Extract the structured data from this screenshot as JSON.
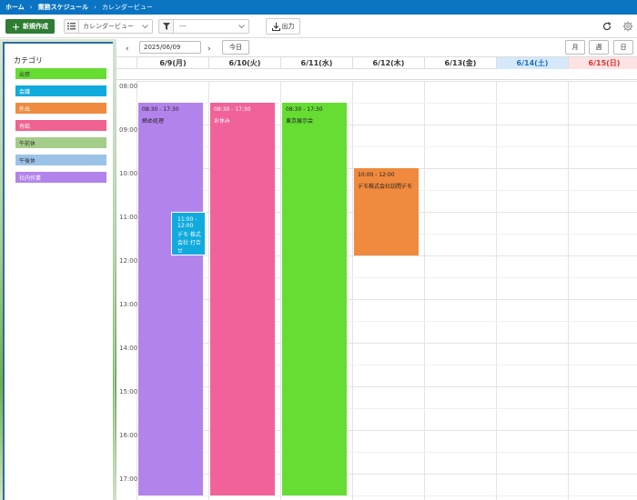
{
  "breadcrumb": [
    "ホーム",
    "業務スケジュール",
    "カレンダービュー"
  ],
  "toolbar": {
    "new_label": "新規作成",
    "view_value": "カレンダービュー",
    "filter_value": "---",
    "export_label": "出力"
  },
  "sidebar": {
    "title": "カテゴリ",
    "categories": [
      {
        "label": "出張",
        "color": "#66dd33"
      },
      {
        "label": "会議",
        "color": "#11aadd"
      },
      {
        "label": "外出",
        "color": "#f08a3e"
      },
      {
        "label": "有給",
        "color": "#f06292"
      },
      {
        "label": "午前休",
        "color": "#a5cd8a"
      },
      {
        "label": "午後休",
        "color": "#9cc3e8"
      },
      {
        "label": "社内作業",
        "color": "#b383ec"
      }
    ]
  },
  "calendar": {
    "current_date": "2025/06/09",
    "today_label": "今日",
    "view_buttons": [
      "月",
      "週",
      "日"
    ],
    "days": [
      "6/9(月)",
      "6/10(火)",
      "6/11(水)",
      "6/12(木)",
      "6/13(金)",
      "6/14(土)",
      "6/15(日)"
    ],
    "hours": [
      "08:00",
      "09:00",
      "10:00",
      "11:00",
      "12:00",
      "13:00",
      "14:00",
      "15:00",
      "16:00",
      "17:00"
    ],
    "events": [
      {
        "day": 0,
        "start": "08:30",
        "end": "17:30",
        "time": "08:30 - 17:30",
        "title": "締め処理",
        "color": "#b383ec",
        "text_color": "#222"
      },
      {
        "day": 0,
        "start": "11:00",
        "end": "12:00",
        "time": "11:00 - 12:00",
        "title": "デモ 株式会社 打合せ",
        "color": "#11aadd",
        "text_color": "#ffffff"
      },
      {
        "day": 1,
        "start": "08:30",
        "end": "17:30",
        "time": "08:30 - 17:30",
        "title": "お休み",
        "color": "#f06299",
        "text_color": "#ffffff"
      },
      {
        "day": 2,
        "start": "08:30",
        "end": "17:30",
        "time": "08:30 - 17:30",
        "title": "東京展示会",
        "color": "#66dd33",
        "text_color": "#222"
      },
      {
        "day": 3,
        "start": "10:00",
        "end": "12:00",
        "time": "10:00 - 12:00",
        "title": "デモ株式会社訪問デモ",
        "color": "#f08a3e",
        "text_color": "#222"
      }
    ]
  }
}
